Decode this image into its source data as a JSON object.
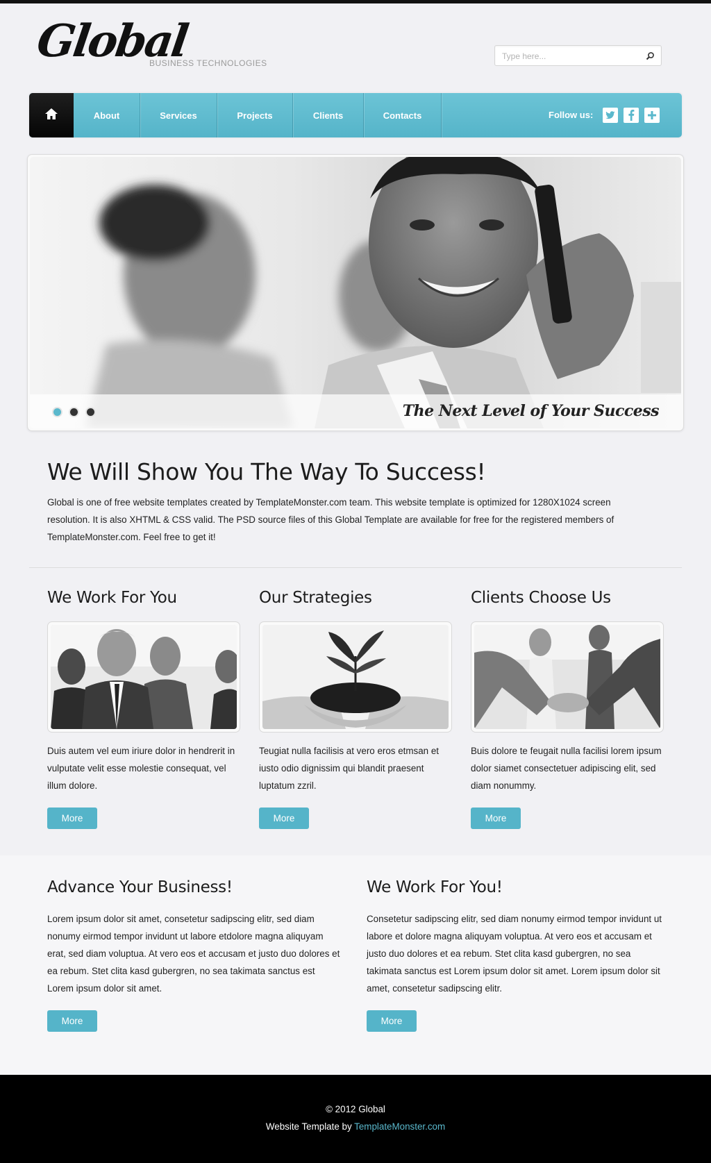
{
  "header": {
    "logo_text": "Global",
    "tagline": "BUSINESS TECHNOLOGIES",
    "search_placeholder": "Type here..."
  },
  "nav": {
    "items": [
      {
        "label": "About"
      },
      {
        "label": "Services"
      },
      {
        "label": "Projects"
      },
      {
        "label": "Clients"
      },
      {
        "label": "Contacts"
      }
    ],
    "follow_label": "Follow us:"
  },
  "slider": {
    "caption": "The Next Level of Your Success",
    "slides_count": 3,
    "active_slide": 1
  },
  "intro": {
    "title": "We Will Show You The Way To Success!",
    "text": "Global is one of free website templates created by TemplateMonster.com team. This website template is optimized for 1280X1024 screen resolution. It is also XHTML & CSS valid. The PSD source files of this Global Template are available for free for the registered members of TemplateMonster.com. Feel free to get it!"
  },
  "columns": [
    {
      "title": "We Work For You",
      "text": "Duis autem vel eum iriure dolor in hendrerit in vulputate velit esse molestie consequat, vel illum dolore.",
      "button": "More"
    },
    {
      "title": "Our Strategies",
      "text": "Teugiat nulla facilisis at vero eros etmsan et iusto odio dignissim qui blandit praesent luptatum zzril.",
      "button": "More"
    },
    {
      "title": "Clients Choose Us",
      "text": "Buis dolore te feugait nulla facilisi lorem ipsum dolor siamet consectetuer adipiscing elit, sed diam nonummy.",
      "button": "More"
    }
  ],
  "bottom": [
    {
      "title": "Advance Your Business!",
      "text": "Lorem ipsum dolor sit amet, consetetur sadipscing elitr, sed diam nonumy eirmod tempor invidunt ut labore etdolore magna aliquyam erat, sed diam voluptua. At vero eos et accusam et justo duo dolores et ea rebum. Stet clita kasd gubergren, no sea takimata sanctus est Lorem ipsum dolor sit amet.",
      "button": "More"
    },
    {
      "title": "We Work For You!",
      "text": "Consetetur sadipscing elitr, sed diam nonumy eirmod tempor invidunt ut labore et dolore magna aliquyam voluptua. At vero eos et accusam et justo duo dolores et ea rebum. Stet clita kasd gubergren, no sea takimata sanctus est Lorem ipsum dolor sit amet. Lorem ipsum dolor sit amet, consetetur sadipscing elitr.",
      "button": "More"
    }
  ],
  "footer": {
    "copyright": "© 2012 Global",
    "credit_prefix": "Website Template by ",
    "credit_link": "TemplateMonster.com"
  },
  "colors": {
    "accent": "#55b4c9",
    "nav_dark": "#111111",
    "footer_bg": "#000000",
    "page_bg": "#f1f1f4"
  },
  "icons": {
    "search": "magnifier-icon",
    "home": "home-icon",
    "social": [
      "twitter-icon",
      "facebook-icon",
      "plus-icon"
    ]
  }
}
